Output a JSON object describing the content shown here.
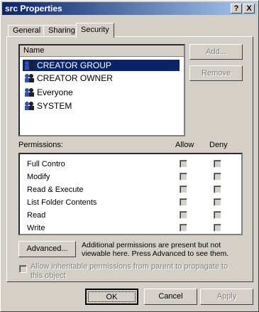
{
  "window": {
    "title": "src Properties",
    "help_label": "?",
    "close_label": "X"
  },
  "tabs": [
    "General",
    "Sharing",
    "Security"
  ],
  "users": {
    "header": "Name",
    "items": [
      "CREATOR GROUP",
      "CREATOR OWNER",
      "Everyone",
      "SYSTEM"
    ]
  },
  "buttons": {
    "add": "Add...",
    "remove": "Remove",
    "advanced": "Advanced...",
    "ok": "OK",
    "cancel": "Cancel",
    "apply": "Apply"
  },
  "permissions": {
    "title": "Permissions:",
    "allow": "Allow",
    "deny": "Deny",
    "items": [
      "Full Contro",
      "Modify",
      "Read & Execute",
      "List Folder Contents",
      "Read",
      "Write"
    ]
  },
  "advanced_note": "Additional permissions are present but not viewable here. Press Advanced to see them.",
  "inherit_text": "Allow inheritable permissions from parent to propagate to this object"
}
